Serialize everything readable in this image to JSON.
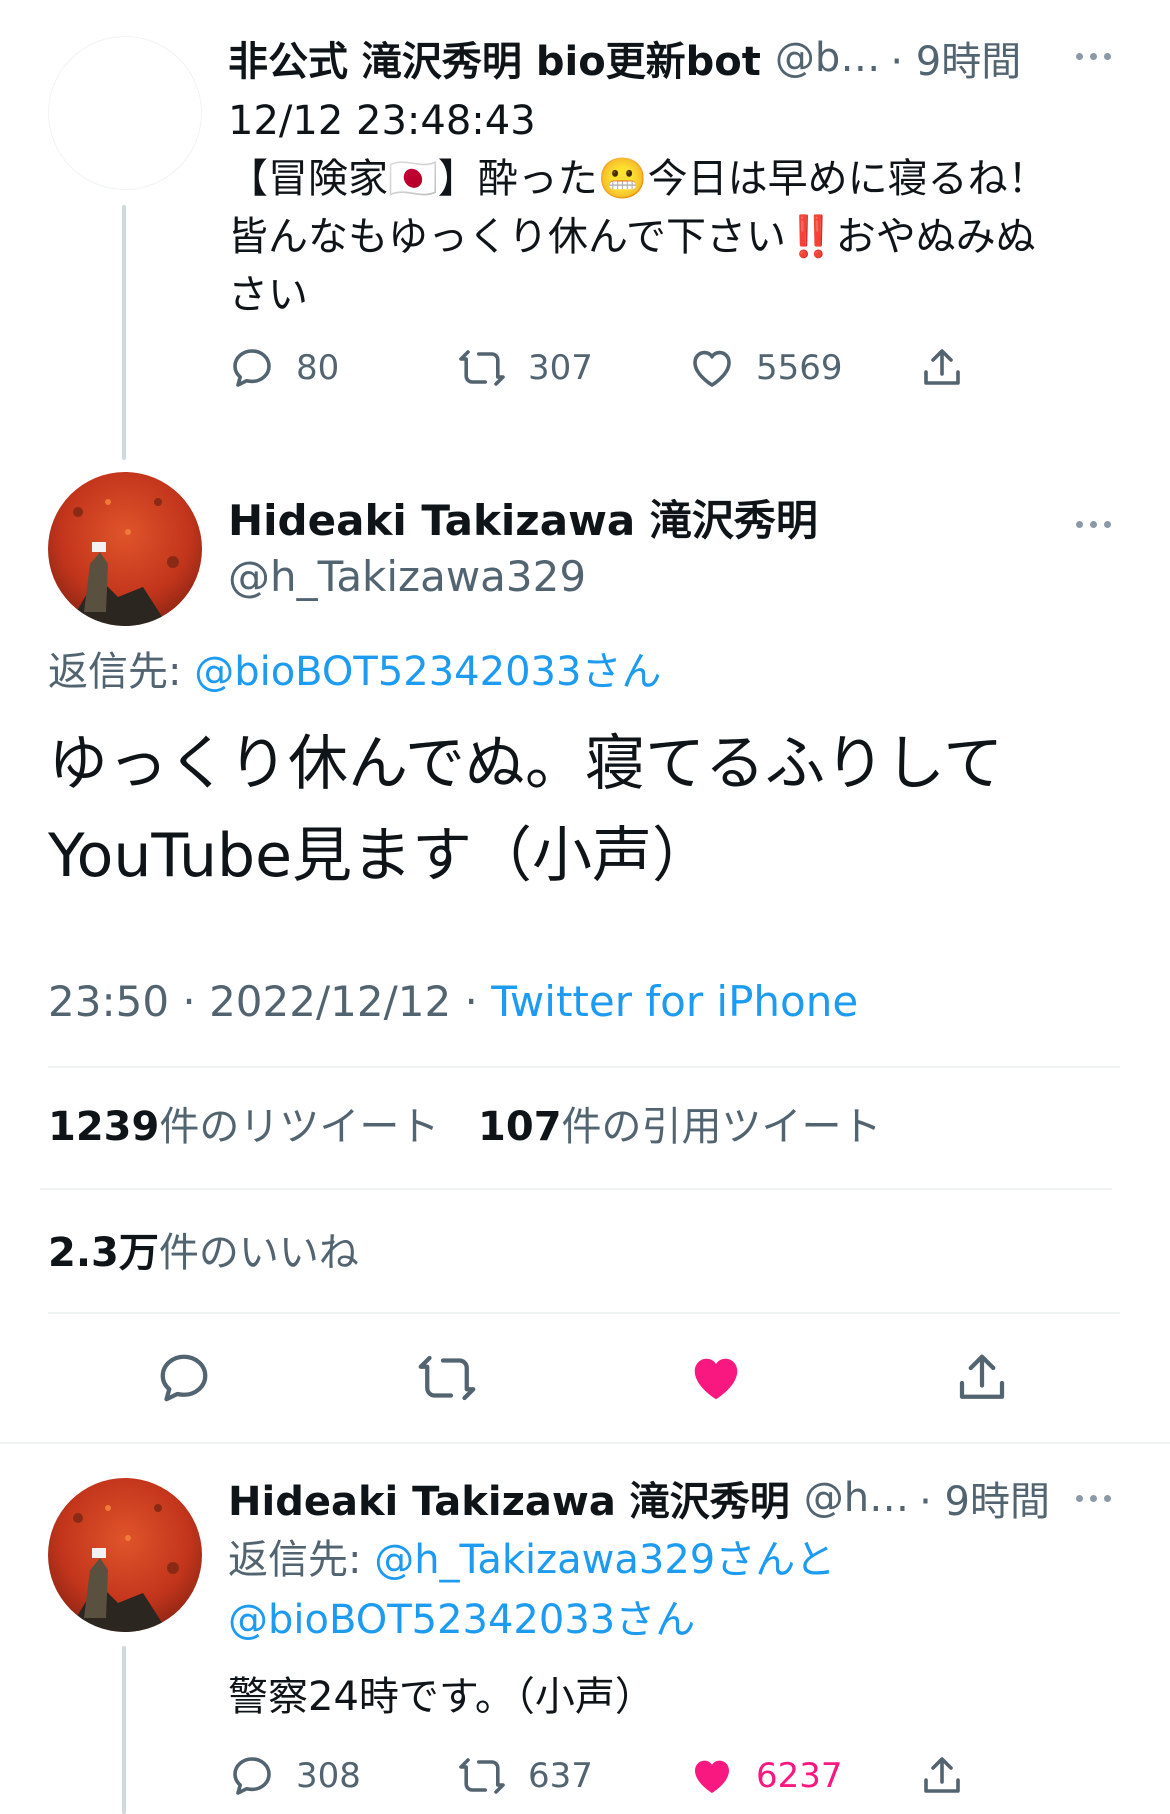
{
  "tweet1": {
    "display_name": "非公式 滝沢秀明 bio更新bot",
    "handle": "@b…",
    "time": "· 9時間",
    "line1": "12/12 23:48:43",
    "line2": "【冒険家🇯🇵】酔った😬今日は早めに寝るね！",
    "line3": "皆んなもゆっくり休んで下さい‼️おやぬみぬ",
    "line4": "さい",
    "reply_count": "80",
    "retweet_count": "307",
    "like_count": "5569"
  },
  "main_tweet": {
    "display_name": "Hideaki Takizawa 滝沢秀明",
    "handle": "@h_Takizawa329",
    "reply_to_label": "返信先:",
    "reply_to_handle": "@bioBOT52342033",
    "reply_to_suffix": "さん",
    "text_line1": "ゆっくり休んでぬ。寝てるふりして",
    "text_line2": "YouTube見ます（小声）",
    "timestamp": "23:50 · 2022/12/12 · ",
    "source": "Twitter for iPhone",
    "retweets_num": "1239",
    "retweets_label": "件のリツイート",
    "quotes_num": "107",
    "quotes_label": "件の引用ツイート",
    "likes_num": "2.3万",
    "likes_label": "件のいいね",
    "liked": true,
    "like_color": "#f91880"
  },
  "tweet3": {
    "display_name": "Hideaki Takizawa 滝沢秀明",
    "handle": "@h…",
    "time": "· 9時間",
    "reply_to_label": "返信先:",
    "reply_to_handle1": "@h_Takizawa329",
    "reply_to_mid": "さんと",
    "reply_to_handle2": "@bioBOT52342033",
    "reply_to_suffix": "さん",
    "text": "警察24時です。（小声）",
    "reply_count": "308",
    "retweet_count": "637",
    "like_count": "6237",
    "liked": true
  },
  "colors": {
    "accent": "#1d9bf0",
    "like": "#f91880",
    "muted": "#536471"
  }
}
